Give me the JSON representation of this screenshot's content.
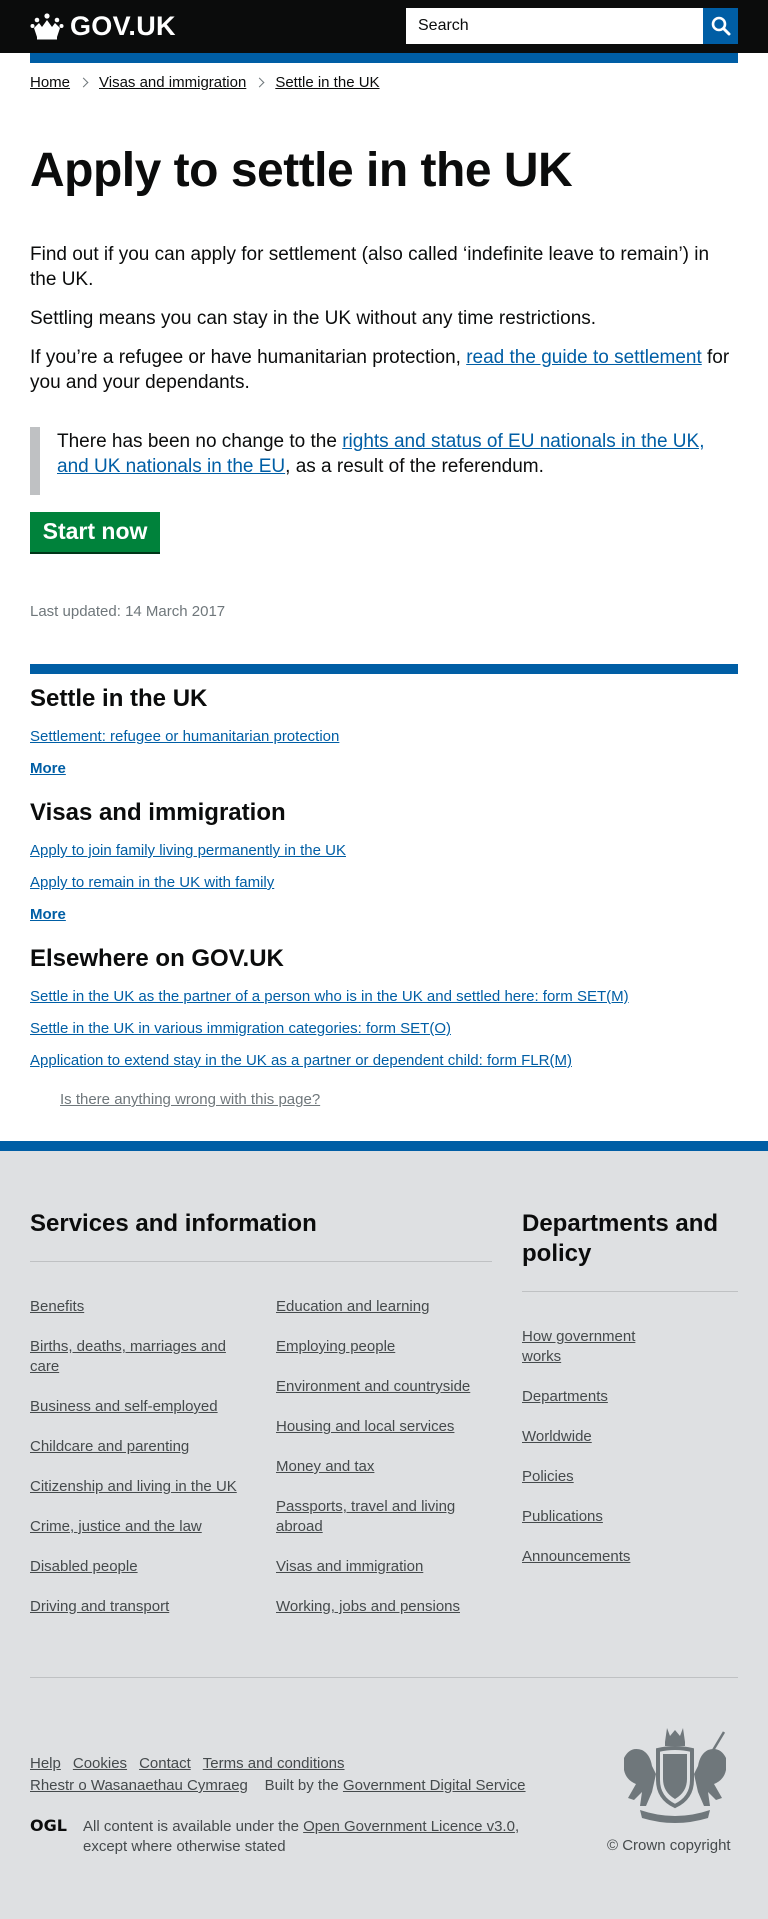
{
  "header": {
    "logo_text": "GOV.UK",
    "logo_icon": "crown-icon",
    "search_placeholder": "Search",
    "search_icon": "search-icon"
  },
  "breadcrumb": [
    {
      "label": "Home"
    },
    {
      "label": "Visas and immigration"
    },
    {
      "label": "Settle in the UK"
    }
  ],
  "main": {
    "title": "Apply to settle in the UK",
    "intro1": "Find out if you can apply for settlement (also called ‘indefinite leave to remain’) in the UK.",
    "intro2": "Settling means you can stay in the UK without any time restrictions.",
    "intro3_before": "If you’re a refugee or have humanitarian protection, ",
    "intro3_link": "read the guide to settlement",
    "intro3_after": " for you and your dependants.",
    "callout_before": "There has been no change to the ",
    "callout_link": "rights and status of EU nationals in the UK, and UK nationals in the EU",
    "callout_after": ", as a result of the referendum.",
    "start_button": "Start now",
    "last_updated": "Last updated: 14 March 2017"
  },
  "related": {
    "settle": {
      "heading": "Settle in the UK",
      "links": [
        "Settlement: refugee or humanitarian protection"
      ],
      "more": "More"
    },
    "visas": {
      "heading": "Visas and immigration",
      "links": [
        "Apply to join family living permanently in the UK",
        "Apply to remain in the UK with family"
      ],
      "more": "More"
    },
    "elsewhere": {
      "heading": "Elsewhere on GOV.UK",
      "links": [
        "Settle in the UK as the partner of a person who is in the UK and settled here: form SET(M)",
        "Settle in the UK in various immigration categories: form SET(O)",
        "Application to extend stay in the UK as a partner or dependent child: form FLR(M)"
      ]
    },
    "report": "Is there anything wrong with this page?"
  },
  "footer": {
    "services_heading": "Services and information",
    "services_col1": [
      "Benefits",
      "Births, deaths, marriages and care",
      "Business and self-employed",
      "Childcare and parenting",
      "Citizenship and living in the UK",
      "Crime, justice and the law",
      "Disabled people",
      "Driving and transport"
    ],
    "services_col2": [
      "Education and learning",
      "Employing people",
      "Environment and countryside",
      "Housing and local services",
      "Money and tax",
      "Passports, travel and living abroad",
      "Visas and immigration",
      "Working, jobs and pensions"
    ],
    "departments_heading": "Departments and policy",
    "departments": [
      "How government works",
      "Departments",
      "Worldwide",
      "Policies",
      "Publications",
      "Announcements"
    ],
    "meta": [
      "Help",
      "Cookies",
      "Contact",
      "Terms and conditions"
    ],
    "welsh": "Rhestr o Wasanaethau Cymraeg",
    "built_by_prefix": "Built by the ",
    "built_by_link": "Government Digital Service",
    "ogl_text": "OGL",
    "licence_before": "All content is available under the ",
    "licence_link": "Open Government Licence v3.0",
    "licence_after": ", except where otherwise stated",
    "crown_copyright": "© Crown copyright"
  }
}
